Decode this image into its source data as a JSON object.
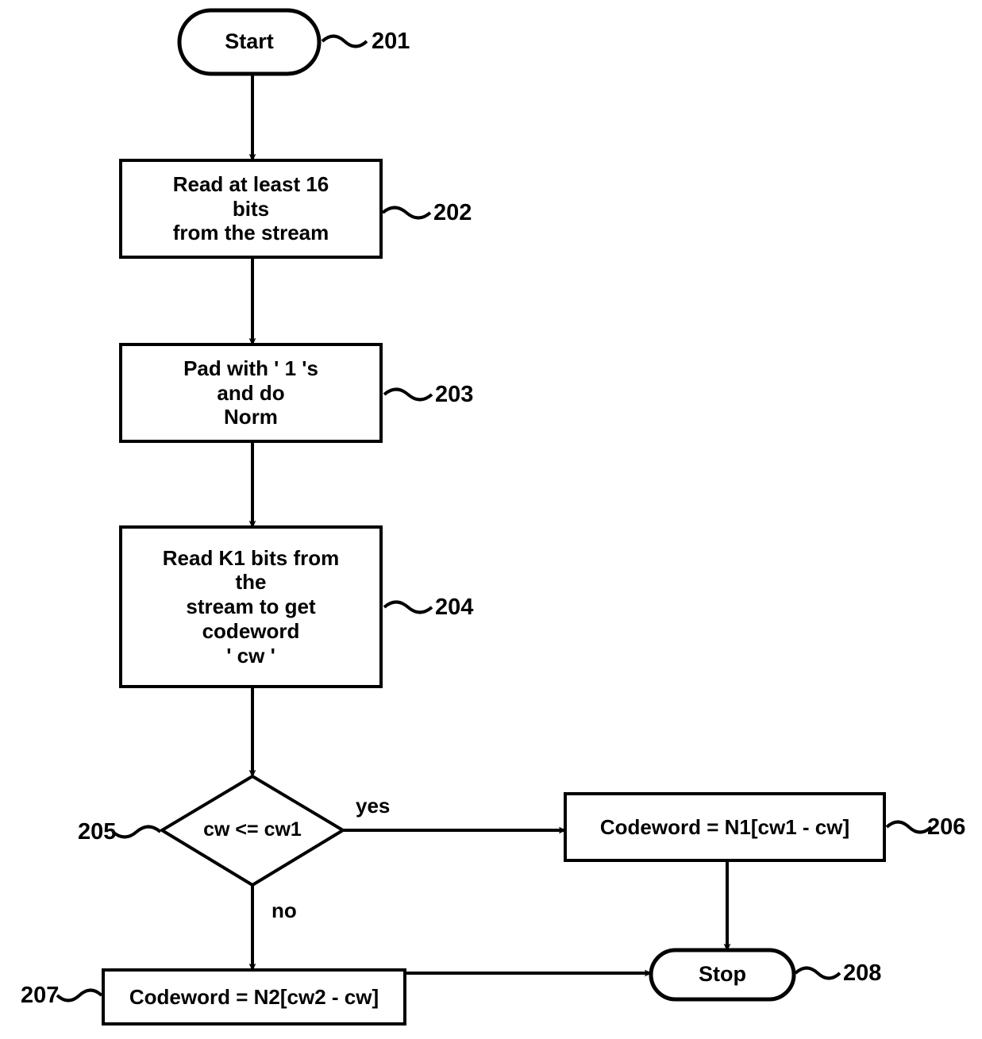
{
  "diagram": {
    "type": "flowchart",
    "title": "",
    "nodes": [
      {
        "id": "start",
        "ref": "201",
        "shape": "terminal",
        "text": "Start"
      },
      {
        "id": "read16",
        "ref": "202",
        "shape": "process",
        "text": "Read at least 16\nbits\nfrom the stream"
      },
      {
        "id": "pad",
        "ref": "203",
        "shape": "process",
        "text": "Pad with ' 1 's\nand do\nNorm"
      },
      {
        "id": "readk1",
        "ref": "204",
        "shape": "process",
        "text": "Read K1 bits from\nthe\nstream to get\ncodeword\n' cw '"
      },
      {
        "id": "decision",
        "ref": "205",
        "shape": "decision",
        "text": "cw <= cw1"
      },
      {
        "id": "n1",
        "ref": "206",
        "shape": "process",
        "text": "Codeword = N1[cw1 - cw]"
      },
      {
        "id": "n2",
        "ref": "207",
        "shape": "process",
        "text": "Codeword = N2[cw2 - cw]"
      },
      {
        "id": "stop",
        "ref": "208",
        "shape": "terminal",
        "text": "Stop"
      }
    ],
    "edge_labels": {
      "yes": "yes",
      "no": "no"
    },
    "colors": {
      "stroke": "#000000",
      "fill": "#ffffff",
      "text": "#000000"
    }
  }
}
